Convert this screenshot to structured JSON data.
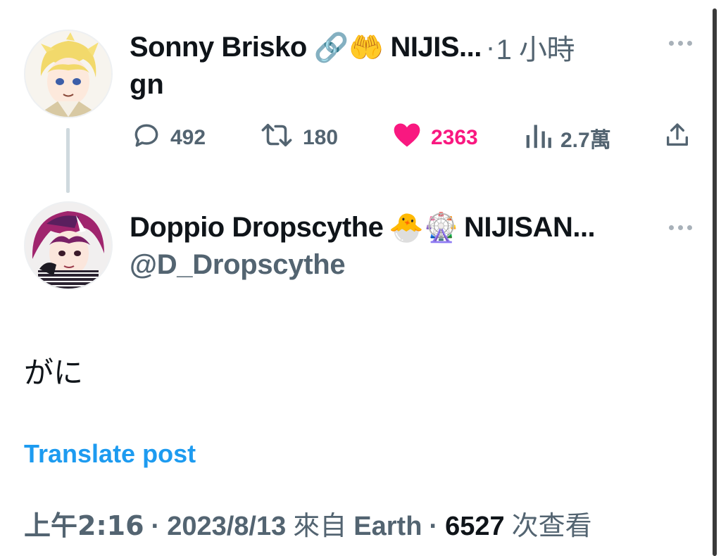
{
  "parent_tweet": {
    "display_name": "Sonny Brisko",
    "name_emojis": "🔗🤲",
    "name_suffix": "NIJIS...",
    "time_sep": "·",
    "time": "1 小時",
    "text": "gn",
    "stats": {
      "replies": "492",
      "retweets": "180",
      "likes": "2363",
      "views": "2.7萬"
    },
    "liked_color": "#f91880",
    "avatar_icon": "sonny-avatar"
  },
  "main_tweet": {
    "display_name": "Doppio Dropscythe",
    "name_emojis": "🐣🎡",
    "name_suffix": "NIJISAN...",
    "handle": "@D_Dropscythe",
    "text": "がに",
    "translate_label": "Translate post",
    "meta": {
      "time": "上午2:16",
      "sep1": "·",
      "date": "2023/8/13",
      "source_prefix": "來自",
      "source": "Earth",
      "sep2": "·",
      "views_count": "6527",
      "views_label": "次查看"
    },
    "avatar_icon": "doppio-avatar"
  },
  "colors": {
    "link_blue": "#1d9bf0",
    "secondary_text": "#536471",
    "thread_line": "#cfd9de"
  }
}
